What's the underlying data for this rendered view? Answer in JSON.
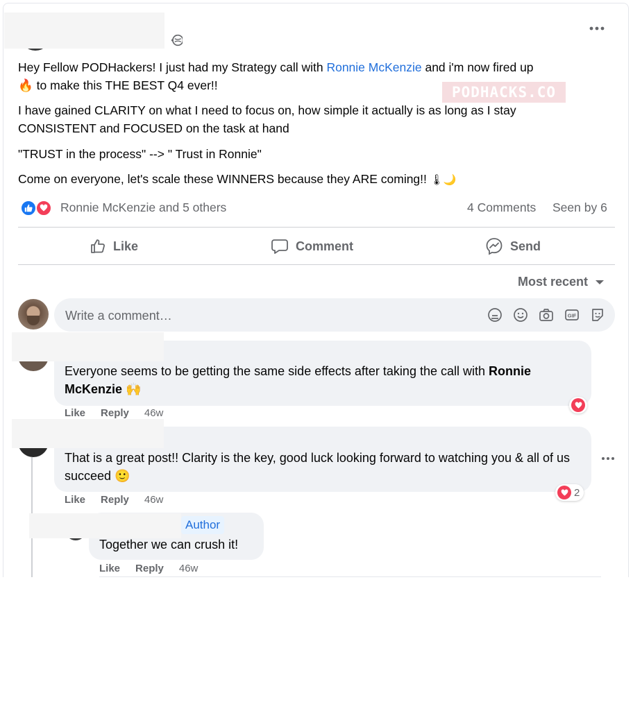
{
  "post": {
    "line1_a": "Hey Fellow PODHackers! I just had my Strategy call with ",
    "line1_link": "Ronnie McKenzie",
    "line1_b": " and i'm now fired up",
    "line2_emoji": "🔥",
    "line2_text": " to make this THE BEST Q4 ever!!",
    "paragraph2": "I have gained CLARITY on what I need to focus on, how simple it actually is as long as I stay CONSISTENT and FOCUSED on the task at hand",
    "paragraph3": "\"TRUST in the process\" --> \" Trust in Ronnie\"",
    "paragraph4": "Come on everyone, let's scale these WINNERS because they ARE coming!!",
    "paragraph4_emoji": "🌡🌙"
  },
  "watermark": "PODHACKS.CO",
  "reactions": {
    "summary": "Ronnie McKenzie and 5 others",
    "comments": "4 Comments",
    "seen_by": "Seen by 6"
  },
  "actions": {
    "like": "Like",
    "comment": "Comment",
    "send": "Send"
  },
  "sort": {
    "label": "Most recent"
  },
  "composer": {
    "placeholder": "Write a comment…"
  },
  "comments": [
    {
      "text_a": "Everyone seems to be getting the same side effects after taking the call with ",
      "text_bold": "Ronnie McKenzie",
      "text_emoji": " 🙌",
      "like": "Like",
      "reply": "Reply",
      "time": "46w"
    },
    {
      "text": "That is a great post!! Clarity is the key, good luck looking forward to watching you & all of us succeed 🙂",
      "like": "Like",
      "reply": "Reply",
      "time": "46w",
      "reaction_count": "2"
    }
  ],
  "reply": {
    "badge": "Author",
    "text": "Together we can crush it!",
    "like": "Like",
    "reply": "Reply",
    "time": "46w"
  },
  "colors": {
    "link": "#216fdb",
    "muted": "#65676b",
    "bubble": "#f0f2f5",
    "like_blue": "#1877f2",
    "love_red": "#f33e58"
  }
}
